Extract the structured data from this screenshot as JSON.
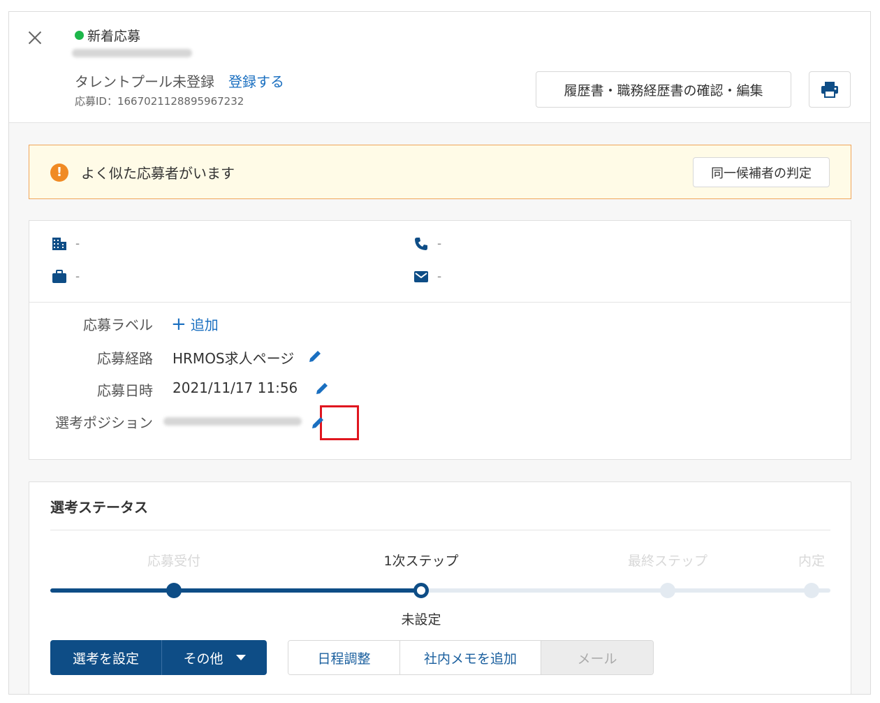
{
  "header": {
    "status": "新着応募",
    "talent_pool_status": "タレントプール未登録",
    "register_link": "登録する",
    "application_id": "応募ID：1667021128895967232",
    "resume_button": "履歴書・職務経歴書の確認・編集"
  },
  "alert": {
    "icon": "!",
    "message": "よく似た応募者がいます",
    "judge_button": "同一候補者の判定"
  },
  "contact": {
    "company": "-",
    "phone": "-",
    "job": "-",
    "email": "-"
  },
  "fields": {
    "label_label": "応募ラベル",
    "label_add": "追加",
    "route_label": "応募経路",
    "route_value": "HRMOS求人ページ",
    "date_label": "応募日時",
    "date_value": "2021/11/17 11:56",
    "position_label": "選考ポジション"
  },
  "selection_status": {
    "title": "選考ステータス",
    "steps": [
      "応募受付",
      "1次ステップ",
      "最終ステップ",
      "内定"
    ],
    "current_step_index": 1,
    "current_step_status": "未設定",
    "buttons": {
      "set_selection": "選考を設定",
      "other": "その他",
      "schedule": "日程調整",
      "add_memo": "社内メモを追加",
      "mail": "メール"
    }
  },
  "colors": {
    "primary": "#0e4d86",
    "link": "#1a6fc0",
    "alert_border": "#f0a55a",
    "alert_icon": "#f08a24",
    "new_dot": "#1db64a",
    "highlight": "#e0161f"
  }
}
